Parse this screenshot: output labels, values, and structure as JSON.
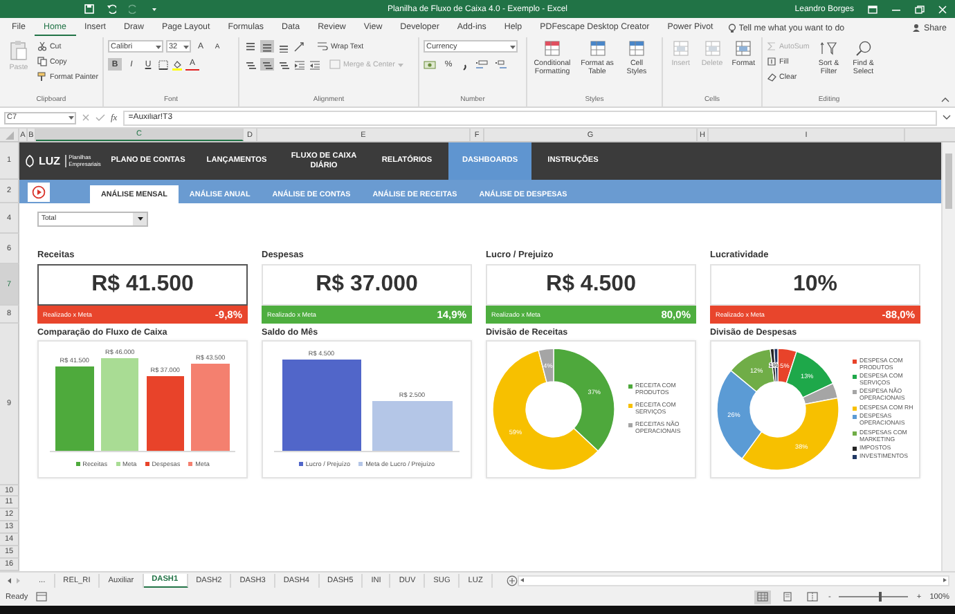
{
  "window": {
    "title": "Planilha de Fluxo de Caixa 4.0 - Exemplo - Excel",
    "user": "Leandro Borges"
  },
  "menu_tabs": [
    {
      "label": "File",
      "selected": false
    },
    {
      "label": "Home",
      "selected": true
    },
    {
      "label": "Insert",
      "selected": false
    },
    {
      "label": "Draw",
      "selected": false
    },
    {
      "label": "Page Layout",
      "selected": false
    },
    {
      "label": "Formulas",
      "selected": false
    },
    {
      "label": "Data",
      "selected": false
    },
    {
      "label": "Review",
      "selected": false
    },
    {
      "label": "View",
      "selected": false
    },
    {
      "label": "Developer",
      "selected": false
    },
    {
      "label": "Add-ins",
      "selected": false
    },
    {
      "label": "Help",
      "selected": false
    },
    {
      "label": "PDFescape Desktop Creator",
      "selected": false
    },
    {
      "label": "Power Pivot",
      "selected": false
    }
  ],
  "tell_me": {
    "placeholder": "Tell me what you want to do"
  },
  "share": "Share",
  "ribbon": {
    "clipboard": {
      "label": "Clipboard",
      "paste": "Paste",
      "items": [
        "Cut",
        "Copy",
        "Format Painter"
      ]
    },
    "font": {
      "label": "Font",
      "name": "Calibri",
      "size": "32",
      "grow": "A",
      "shrink": "A",
      "styles": [
        {
          "label": "B",
          "selected": true
        },
        {
          "label": "I",
          "selected": false
        },
        {
          "label": "U",
          "selected": false
        }
      ],
      "font_color": "A"
    },
    "alignment": {
      "label": "Alignment",
      "vertical_align": [
        {
          "selected": false
        },
        {
          "selected": true
        },
        {
          "selected": false
        }
      ],
      "horizontal_align": [
        {
          "selected": false
        },
        {
          "selected": true
        },
        {
          "selected": false
        }
      ],
      "wrap": "Wrap Text",
      "merge": {
        "label": "Merge & Center",
        "disabled": true
      }
    },
    "number": {
      "label": "Number",
      "format": "Currency",
      "percent": "%"
    },
    "styles": {
      "label": "Styles",
      "items": [
        "Conditional Formatting",
        "Format as Table",
        "Cell Styles"
      ]
    },
    "cells": {
      "label": "Cells",
      "items": [
        {
          "label": "Insert",
          "disabled": true
        },
        {
          "label": "Delete",
          "disabled": true
        },
        {
          "label": "Format",
          "disabled": false
        }
      ]
    },
    "editing": {
      "label": "Editing",
      "items": [
        {
          "label": "AutoSum",
          "disabled": true
        },
        {
          "label": "Fill",
          "disabled": false
        },
        {
          "label": "Clear",
          "disabled": false
        }
      ],
      "sort": "Sort & Filter",
      "find": "Find & Select"
    }
  },
  "formula_bar": {
    "name_box": "C7",
    "fx": "fx",
    "formula": "=Auxiliar!T3"
  },
  "columns": [
    {
      "label": "A",
      "selected": false
    },
    {
      "label": "B",
      "selected": false
    },
    {
      "label": "C",
      "selected": true
    },
    {
      "label": "D",
      "selected": false
    },
    {
      "label": "E",
      "selected": false
    },
    {
      "label": "F",
      "selected": false
    },
    {
      "label": "G",
      "selected": false
    },
    {
      "label": "H",
      "selected": false
    },
    {
      "label": "I",
      "selected": false
    }
  ],
  "rows": [
    {
      "label": "1",
      "selected": false
    },
    {
      "label": "2",
      "selected": false
    },
    {
      "label": "4",
      "selected": false
    },
    {
      "label": "6",
      "selected": false
    },
    {
      "label": "7",
      "selected": true
    },
    {
      "label": "8",
      "selected": false
    },
    {
      "label": "9",
      "selected": false
    },
    {
      "label": "10",
      "selected": false
    },
    {
      "label": "11",
      "selected": false
    },
    {
      "label": "12",
      "selected": false
    },
    {
      "label": "13",
      "selected": false
    },
    {
      "label": "14",
      "selected": false
    },
    {
      "label": "15",
      "selected": false
    },
    {
      "label": "16",
      "selected": false
    }
  ],
  "nav": {
    "logo": "LUZ",
    "tagline": "Planilhas Empresariais",
    "items": [
      {
        "label": "PLANO DE CONTAS",
        "selected": false
      },
      {
        "label": "LANÇAMENTOS",
        "selected": false
      },
      {
        "label": "FLUXO DE CAIXA DIÁRIO",
        "selected": false
      },
      {
        "label": "RELATÓRIOS",
        "selected": false
      },
      {
        "label": "DASHBOARDS",
        "selected": true
      },
      {
        "label": "INSTRUÇÕES",
        "selected": false
      }
    ]
  },
  "subnav": [
    {
      "label": "ANÁLISE MENSAL",
      "selected": true
    },
    {
      "label": "ANÁLISE ANUAL",
      "selected": false
    },
    {
      "label": "ANÁLISE DE CONTAS",
      "selected": false
    },
    {
      "label": "ANÁLISE DE RECEITAS",
      "selected": false
    },
    {
      "label": "ANÁLISE DE DESPESAS",
      "selected": false
    }
  ],
  "filter": {
    "value": "Total"
  },
  "kpis": [
    {
      "title": "Receitas",
      "value": "R$ 41.500",
      "footer_label": "Realizado x Meta",
      "footer_value": "-9,8%",
      "color": "#e8452c",
      "selected": true
    },
    {
      "title": "Despesas",
      "value": "R$ 37.000",
      "footer_label": "Realizado x Meta",
      "footer_value": "14,9%",
      "color": "#4eae3f",
      "selected": false
    },
    {
      "title": "Lucro / Prejuizo",
      "value": "R$ 4.500",
      "footer_label": "Realizado x Meta",
      "footer_value": "80,0%",
      "color": "#4eae3f",
      "selected": false
    },
    {
      "title": "Lucratividade",
      "value": "10%",
      "footer_label": "Realizado x Meta",
      "footer_value": "-88,0%",
      "color": "#e8452c",
      "selected": false
    }
  ],
  "charts": [
    {
      "title": "Comparação do Fluxo de Caixa",
      "kind": "bars",
      "bars": [
        {
          "value": "R$ 41.500",
          "name": "Receitas",
          "color": "#4eaa3c",
          "level": 0.83
        },
        {
          "value": "R$ 46.000",
          "name": "Meta",
          "color": "#a9dc94",
          "level": 0.92
        },
        {
          "value": "R$ 37.000",
          "name": "Despesas",
          "color": "#e8432a",
          "level": 0.74
        },
        {
          "value": "R$ 43.500",
          "name": "Meta",
          "color": "#f4806f",
          "level": 0.87
        }
      ]
    },
    {
      "title": "Saldo do Mês",
      "kind": "bars",
      "bars": [
        {
          "value": "R$ 4.500",
          "name": "Lucro / Prejuízo",
          "color": "#5166c9",
          "level": 0.9
        },
        {
          "value": "R$ 2.500",
          "name": "Meta de Lucro / Prejuízo",
          "color": "#b4c6e7",
          "level": 0.5
        }
      ]
    },
    {
      "title": "Divisão de Receitas",
      "kind": "donut",
      "chart_data": {
        "type": "donut",
        "legend": "right",
        "categories": [
          "RECEITA COM PRODUTOS",
          "RECEITA COM SERVIÇOS",
          "RECEITAS NÃO OPERACIONAIS"
        ],
        "values": [
          37,
          59,
          4
        ],
        "colors": [
          "#4ea83c",
          "#f7c000",
          "#a5a5a5"
        ],
        "value_labels": [
          "37%",
          "59%",
          "4%"
        ]
      }
    },
    {
      "title": "Divisão de Despesas",
      "kind": "donut",
      "chart_data": {
        "type": "donut",
        "legend": "right",
        "categories": [
          "DESPESA COM PRODUTOS",
          "DESPESA COM SERVIÇOS",
          "DESPESA NÃO OPERACIONAIS",
          "DESPESA COM RH",
          "DESPESAS OPERACIONAIS",
          "DESPESAS COM MARKETING",
          "IMPOSTOS",
          "INVESTIMENTOS"
        ],
        "values": [
          5,
          13,
          4,
          38,
          26,
          12,
          1,
          1
        ],
        "colors": [
          "#e8432a",
          "#1ea84a",
          "#a5a5a5",
          "#f7c000",
          "#5b9bd5",
          "#70ad47",
          "#262626",
          "#203864"
        ],
        "value_labels": [
          "5%",
          "13%",
          null,
          "38%",
          "26%",
          "12%",
          "1%",
          null
        ]
      }
    }
  ],
  "sheet_more": "...",
  "sheet_tabs": [
    {
      "label": "REL_RI",
      "selected": false
    },
    {
      "label": "Auxiliar",
      "selected": false
    },
    {
      "label": "DASH1",
      "selected": true
    },
    {
      "label": "DASH2",
      "selected": false
    },
    {
      "label": "DASH3",
      "selected": false
    },
    {
      "label": "DASH4",
      "selected": false
    },
    {
      "label": "DASH5",
      "selected": false
    },
    {
      "label": "INI",
      "selected": false
    },
    {
      "label": "DUV",
      "selected": false
    },
    {
      "label": "SUG",
      "selected": false
    },
    {
      "label": "LUZ",
      "selected": false
    }
  ],
  "status_bar": {
    "text": "Ready",
    "views": [
      {
        "selected": true
      },
      {
        "selected": false
      },
      {
        "selected": false
      }
    ],
    "zoom_out": "-",
    "zoom_in": "+",
    "zoom_slider": {
      "level": 0.6
    },
    "zoom": "100%"
  }
}
